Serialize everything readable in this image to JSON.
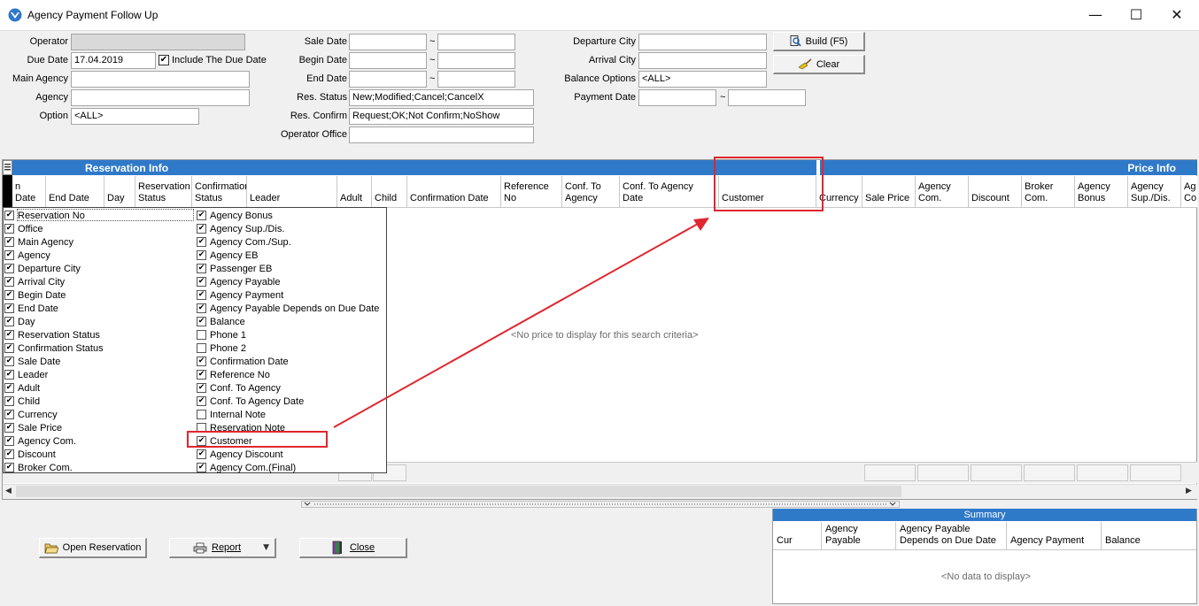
{
  "window": {
    "title": "Agency Payment Follow Up",
    "minimize": "—",
    "maximize": "☐",
    "close": "✕"
  },
  "filters": {
    "operator": {
      "label": "Operator",
      "value": ""
    },
    "due_date": {
      "label": "Due Date",
      "value": "17.04.2019"
    },
    "include_due_date": {
      "label": "Include The Due Date",
      "checked": true
    },
    "main_agency": {
      "label": "Main Agency",
      "value": ""
    },
    "agency": {
      "label": "Agency",
      "value": ""
    },
    "option": {
      "label": "Option",
      "value": "<ALL>"
    },
    "sale_date": {
      "label": "Sale Date",
      "from": "",
      "to": ""
    },
    "begin_date": {
      "label": "Begin Date",
      "from": "",
      "to": ""
    },
    "end_date": {
      "label": "End Date",
      "from": "",
      "to": ""
    },
    "res_status": {
      "label": "Res. Status",
      "value": "New;Modified;Cancel;CancelX"
    },
    "res_confirm": {
      "label": "Res. Confirm",
      "value": "Request;OK;Not Confirm;NoShow"
    },
    "operator_office": {
      "label": "Operator Office",
      "value": ""
    },
    "departure_city": {
      "label": "Departure City",
      "value": ""
    },
    "arrival_city": {
      "label": "Arrival City",
      "value": ""
    },
    "balance_options": {
      "label": "Balance Options",
      "value": "<ALL>"
    },
    "payment_date": {
      "label": "Payment Date",
      "from": "",
      "to": ""
    },
    "tilde": "~"
  },
  "actions": {
    "build": "Build (F5)",
    "clear": "Clear"
  },
  "grid": {
    "band_reservation": "Reservation Info",
    "band_price": "Price Info",
    "columns": [
      "n Date",
      "End Date",
      "Day",
      "Reservation Status",
      "Confirmation Status",
      "Leader",
      "Adult",
      "Child",
      "Confirmation Date",
      "Reference No",
      "Conf. To Agency",
      "Conf. To Agency Date",
      "Customer",
      "Currency",
      "Sale Price",
      "Agency Com.",
      "Discount",
      "Broker Com.",
      "Agency Bonus",
      "Agency Sup./Dis.",
      "Ag Co"
    ],
    "empty_message": "<No price to display for this search criteria>"
  },
  "column_chooser": {
    "left": [
      {
        "label": "Reservation No",
        "checked": true
      },
      {
        "label": "Office",
        "checked": true
      },
      {
        "label": "Main Agency",
        "checked": true
      },
      {
        "label": "Agency",
        "checked": true
      },
      {
        "label": "Departure City",
        "checked": true
      },
      {
        "label": "Arrival City",
        "checked": true
      },
      {
        "label": "Begin Date",
        "checked": true
      },
      {
        "label": "End Date",
        "checked": true
      },
      {
        "label": "Day",
        "checked": true
      },
      {
        "label": "Reservation Status",
        "checked": true
      },
      {
        "label": "Confirmation Status",
        "checked": true
      },
      {
        "label": "Sale Date",
        "checked": true
      },
      {
        "label": "Leader",
        "checked": true
      },
      {
        "label": "Adult",
        "checked": true
      },
      {
        "label": "Child",
        "checked": true
      },
      {
        "label": "Currency",
        "checked": true
      },
      {
        "label": "Sale Price",
        "checked": true
      },
      {
        "label": "Agency Com.",
        "checked": true
      },
      {
        "label": "Discount",
        "checked": true
      },
      {
        "label": "Broker Com.",
        "checked": true
      }
    ],
    "right": [
      {
        "label": "Agency Bonus",
        "checked": true
      },
      {
        "label": "Agency Sup./Dis.",
        "checked": true
      },
      {
        "label": "Agency Com./Sup.",
        "checked": true
      },
      {
        "label": "Agency EB",
        "checked": true
      },
      {
        "label": "Passenger EB",
        "checked": true
      },
      {
        "label": "Agency Payable",
        "checked": true
      },
      {
        "label": "Agency Payment",
        "checked": true
      },
      {
        "label": "Agency Payable Depends on Due Date",
        "checked": true
      },
      {
        "label": "Balance",
        "checked": true
      },
      {
        "label": "Phone 1",
        "checked": false
      },
      {
        "label": "Phone 2",
        "checked": false
      },
      {
        "label": "Confirmation Date",
        "checked": true
      },
      {
        "label": "Reference No",
        "checked": true
      },
      {
        "label": "Conf. To Agency",
        "checked": true
      },
      {
        "label": "Conf. To Agency Date",
        "checked": true
      },
      {
        "label": "Internal Note",
        "checked": false
      },
      {
        "label": "Reservation Note",
        "checked": false
      },
      {
        "label": "Customer",
        "checked": true
      },
      {
        "label": "Agency Discount",
        "checked": true
      },
      {
        "label": "Agency Com.(Final)",
        "checked": true
      }
    ]
  },
  "bottom_buttons": {
    "open_reservation": "Open Reservation",
    "report": "Report",
    "close": "Close"
  },
  "summary": {
    "title": "Summary",
    "columns": [
      "Cur",
      "Agency Payable",
      "Agency Payable Depends on Due Date",
      "Agency Payment",
      "Balance"
    ],
    "empty_message": "<No data to display>"
  },
  "colors": {
    "band_blue": "#2f79c9",
    "annotation_red": "#e0262e"
  }
}
